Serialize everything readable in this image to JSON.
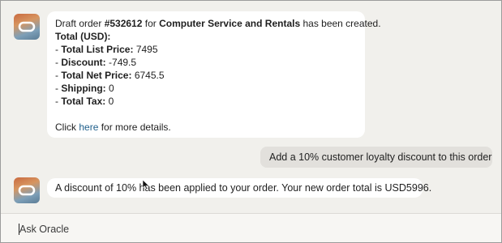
{
  "assistant": {
    "avatar_icon": "oracle-logo-icon",
    "message1": {
      "prefix": "Draft order ",
      "order_number": "#532612",
      "middle": " for ",
      "customer": "Computer Service and Rentals",
      "suffix": " has been created.",
      "total_heading": "Total (USD):",
      "items": [
        {
          "dash": "- ",
          "label": "Total List Price:",
          "value": " 7495"
        },
        {
          "dash": "- ",
          "label": "Discount:",
          "value": " -749.5"
        },
        {
          "dash": "- ",
          "label": "Total Net Price:",
          "value": " 6745.5"
        },
        {
          "dash": "- ",
          "label": "Shipping:",
          "value": " 0"
        },
        {
          "dash": "- ",
          "label": "Total Tax:",
          "value": " 0"
        }
      ],
      "click_prefix": "Click ",
      "link_text": "here",
      "click_suffix": " for more details."
    },
    "message2": "A discount of 10% has been applied to your order. Your new order total is USD5996."
  },
  "user": {
    "message1": "Add a 10% customer loyalty discount to this order"
  },
  "input": {
    "placeholder": "Ask Oracle",
    "value": ""
  },
  "colors": {
    "background": "#f1f0ec",
    "bubble": "#ffffff",
    "user_bubble": "#e2e0dc",
    "link": "#1f5f8b"
  }
}
